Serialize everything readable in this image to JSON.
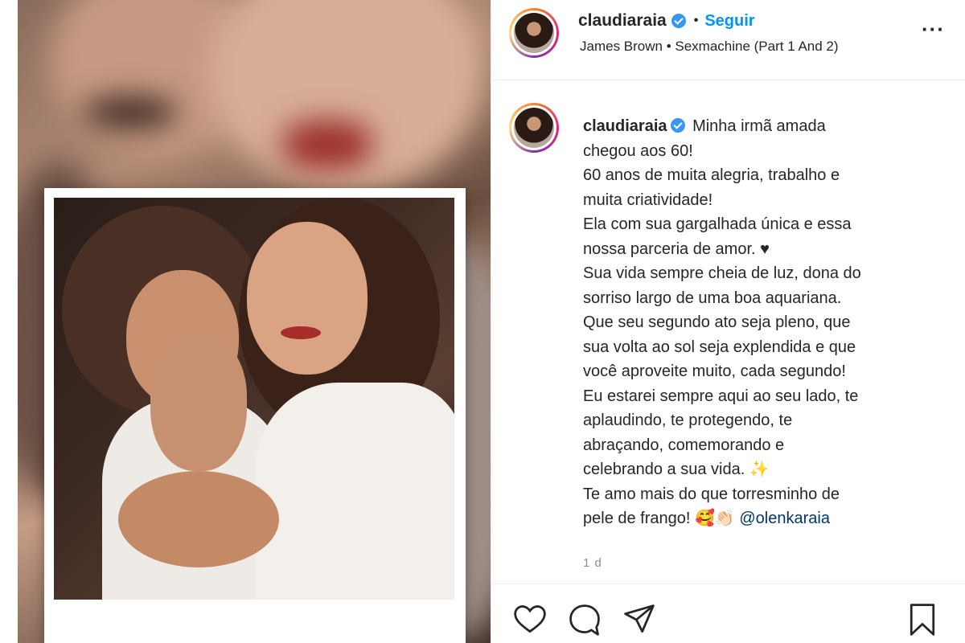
{
  "header": {
    "username": "claudiaraia",
    "separator": "•",
    "follow_label": "Seguir",
    "music": "James Brown • Sexmachine (Part 1 And 2)",
    "more_label": "···"
  },
  "caption": {
    "username": "claudiaraia",
    "lines": [
      "Minha irmã amada",
      "chegou aos 60!",
      "60 anos de muita alegria, trabalho e",
      "muita criatividade!",
      "Ela com sua gargalhada única e essa",
      "nossa parceria de amor. ♥",
      "Sua vida sempre cheia de luz, dona do",
      "sorriso largo de uma boa aquariana.",
      "Que seu segundo ato seja pleno, que",
      "sua volta ao sol seja explendida e que",
      "você aproveite muito, cada segundo!",
      "Eu estarei sempre aqui ao seu lado, te",
      "aplaudindo, te protegendo, te",
      "abraçando, comemorando e",
      "celebrando a sua vida. ✨",
      "Te amo mais do que torresminho de"
    ],
    "last_line_text": "pele de frango! 🥰👏🏻 ",
    "mention": "@olenkaraia",
    "time": "1 d"
  },
  "icons": {
    "like": "heart-icon",
    "comment": "comment-icon",
    "share": "share-icon",
    "save": "bookmark-icon"
  },
  "colors": {
    "follow": "#0095f6",
    "verified": "#3897f0",
    "mention": "#00376b",
    "muted": "#8e8e8e"
  }
}
